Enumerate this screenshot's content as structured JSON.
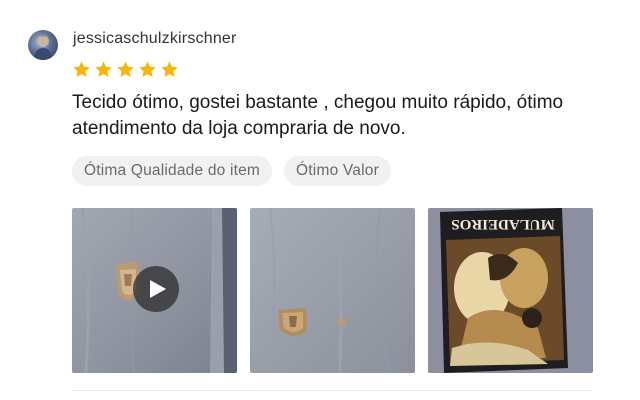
{
  "review": {
    "username": "jessicaschulzkirschner",
    "rating": 5,
    "max_rating": 5,
    "star_color": "#f5b70d",
    "text": "Tecido ótimo,  gostei bastante , chegou muito rápido, ótimo atendimento da loja compraria de novo.",
    "tags": [
      "Ótima Qualidade do item",
      "Ótimo Valor"
    ],
    "photos": [
      {
        "kind": "video",
        "icon": "play-icon"
      },
      {
        "kind": "image"
      },
      {
        "kind": "image",
        "caption_text": "MULADEIROS"
      }
    ]
  }
}
